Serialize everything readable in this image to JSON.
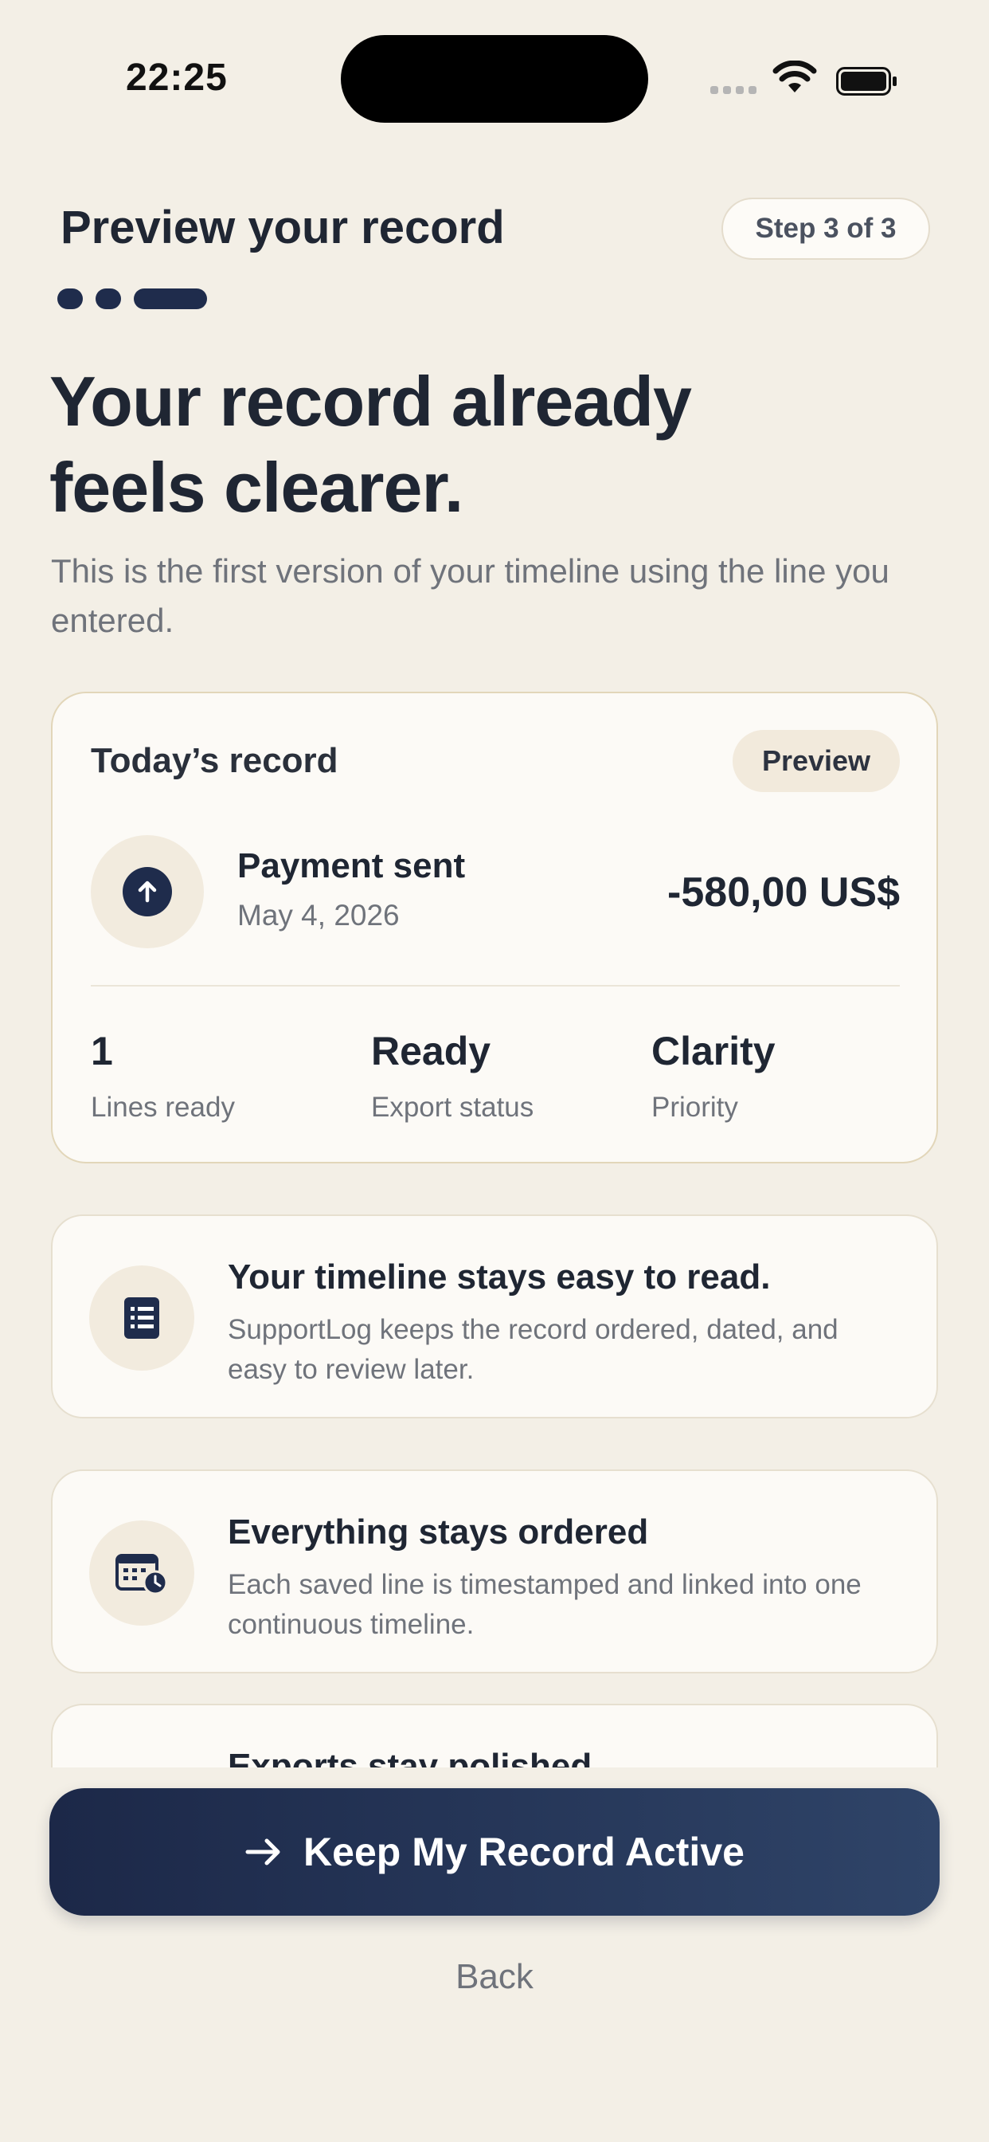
{
  "status_bar": {
    "time": "22:25"
  },
  "header": {
    "title": "Preview your record",
    "step": "Step 3 of 3"
  },
  "hero": {
    "headline_line1": "Your record already",
    "headline_line2": "feels clearer.",
    "subtitle": "This is the first version of your timeline using the line you entered."
  },
  "record_card": {
    "title": "Today’s record",
    "badge": "Preview",
    "payment": {
      "title": "Payment sent",
      "date": "May 4, 2026",
      "amount": "-580,00 US$",
      "icon": "arrow-up-icon"
    },
    "stats": [
      {
        "value": "1",
        "label": "Lines ready"
      },
      {
        "value": "Ready",
        "label": "Export status"
      },
      {
        "value": "Clarity",
        "label": "Priority"
      }
    ]
  },
  "features": [
    {
      "title": "Your timeline stays easy to read.",
      "description": "SupportLog keeps the record ordered, dated, and easy to review later.",
      "icon": "document-list-icon"
    },
    {
      "title": "Everything stays ordered",
      "description": "Each saved line is timestamped and linked into one continuous timeline.",
      "icon": "calendar-clock-icon"
    },
    {
      "title": "Exports stay polished",
      "icon": "export-icon"
    }
  ],
  "cta": {
    "label": "Keep My Record Active",
    "icon": "arrow-right-icon"
  },
  "back": {
    "label": "Back"
  },
  "colors": {
    "background": "#f3efe6",
    "navy": "#1f2c4c",
    "card": "#fcfaf6"
  }
}
